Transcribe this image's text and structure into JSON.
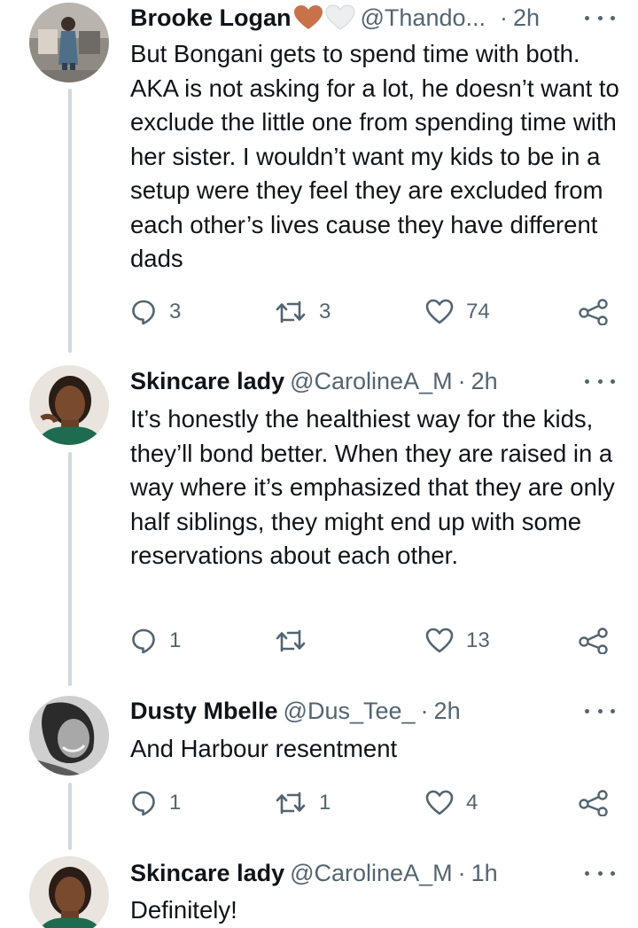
{
  "tweets": [
    {
      "name": "Brooke Logan",
      "handle": "@Thando...",
      "sep": "·",
      "time": "2h",
      "emojis": [
        "orange-heart",
        "white-heart"
      ],
      "text": "But Bongani gets to spend time with both. AKA is not asking for a lot, he doesn’t want to exclude the little one from spending time with her sister. I wouldn’t want my kids to be in a setup were they feel they are excluded from each other’s lives cause they have different dads",
      "replies": "3",
      "retweets": "3",
      "likes": "74"
    },
    {
      "name": "Skincare lady",
      "handle": "@CarolineA_M",
      "sep": "·",
      "time": "2h",
      "text": "It’s honestly the healthiest way for the kids, they’ll bond better. When they are raised in a way where it’s emphasized that they are only half siblings, they might end up with some reservations about each other.",
      "replies": "1",
      "retweets": "",
      "likes": "13"
    },
    {
      "name": "Dusty Mbelle",
      "handle": "@Dus_Tee_",
      "sep": "·",
      "time": "2h",
      "text": "And Harbour resentment",
      "replies": "1",
      "retweets": "1",
      "likes": "4"
    },
    {
      "name": "Skincare lady",
      "handle": "@CarolineA_M",
      "sep": "·",
      "time": "1h",
      "text": "Definitely!"
    }
  ],
  "colors": {
    "text": "#0f1419",
    "secondary": "#536471",
    "thread_line": "#cfd9de",
    "orange_heart": "#c8724a"
  }
}
